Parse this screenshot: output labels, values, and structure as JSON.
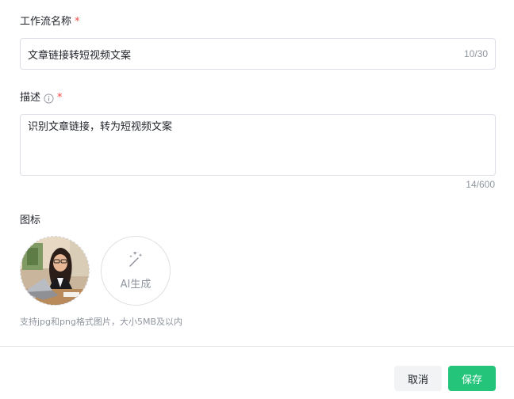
{
  "form": {
    "name": {
      "label": "工作流名称",
      "required_mark": "*",
      "value": "文章链接转短视频文案",
      "counter": "10/30"
    },
    "description": {
      "label": "描述",
      "required_mark": "*",
      "info_icon": "info-circle-icon",
      "value": "识别文章链接，转为短视频文案",
      "counter": "14/600"
    },
    "icon": {
      "label": "图标",
      "ai_generate_label": "AI生成",
      "ai_generate_icon": "magic-wand-icon",
      "hint": "支持jpg和png格式图片，大小5MB及以内"
    }
  },
  "footer": {
    "cancel_label": "取消",
    "save_label": "保存"
  },
  "colors": {
    "required": "#f54a45",
    "primary": "#24c57a",
    "border": "#dcdfe6",
    "muted": "#8f959e"
  }
}
